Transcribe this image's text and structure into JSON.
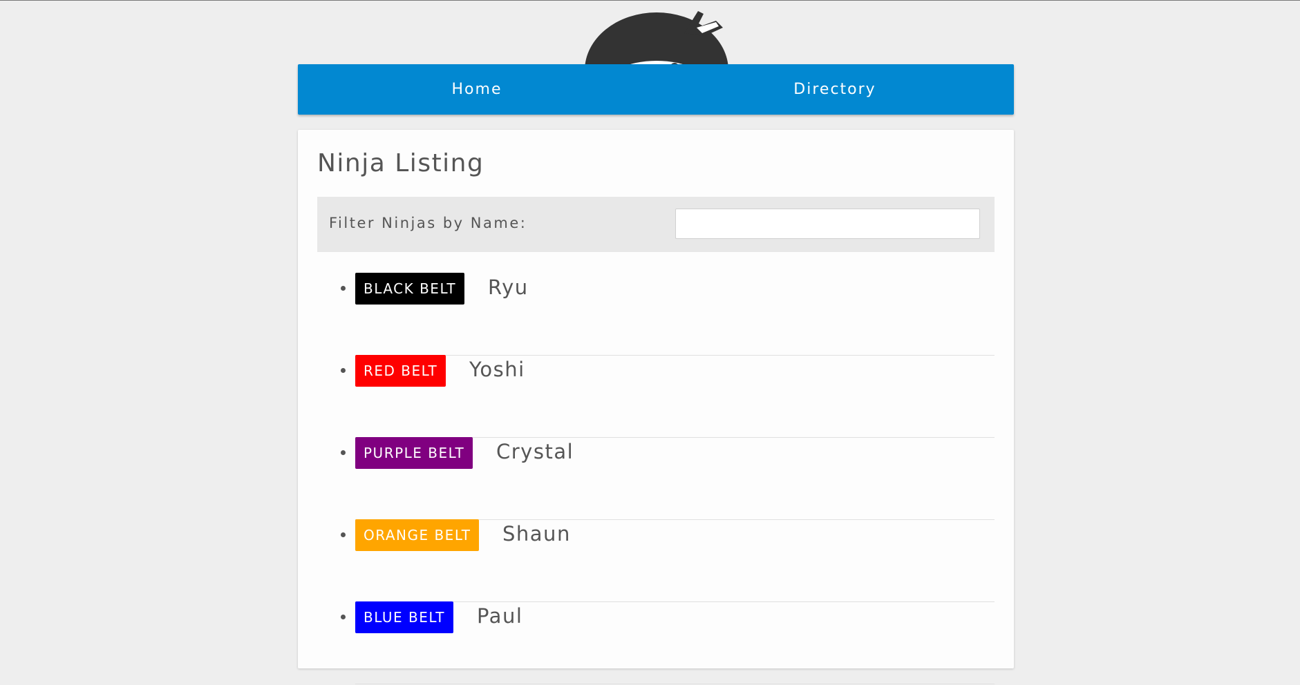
{
  "logo": {
    "icon": "ninja-head-icon"
  },
  "nav": {
    "items": [
      {
        "label": "Home"
      },
      {
        "label": "Directory"
      }
    ],
    "color": "#0288d1"
  },
  "page": {
    "title": "Ninja Listing"
  },
  "filter": {
    "label": "Filter Ninjas by Name:",
    "value": ""
  },
  "ninjas": [
    {
      "belt": "BLACK BELT",
      "belt_color": "#000000",
      "name": "Ryu"
    },
    {
      "belt": "RED BELT",
      "belt_color": "#ff0000",
      "name": "Yoshi"
    },
    {
      "belt": "PURPLE BELT",
      "belt_color": "#800080",
      "name": "Crystal"
    },
    {
      "belt": "ORANGE BELT",
      "belt_color": "#ffa500",
      "name": "Shaun"
    },
    {
      "belt": "BLUE BELT",
      "belt_color": "#0000ff",
      "name": "Paul"
    }
  ]
}
